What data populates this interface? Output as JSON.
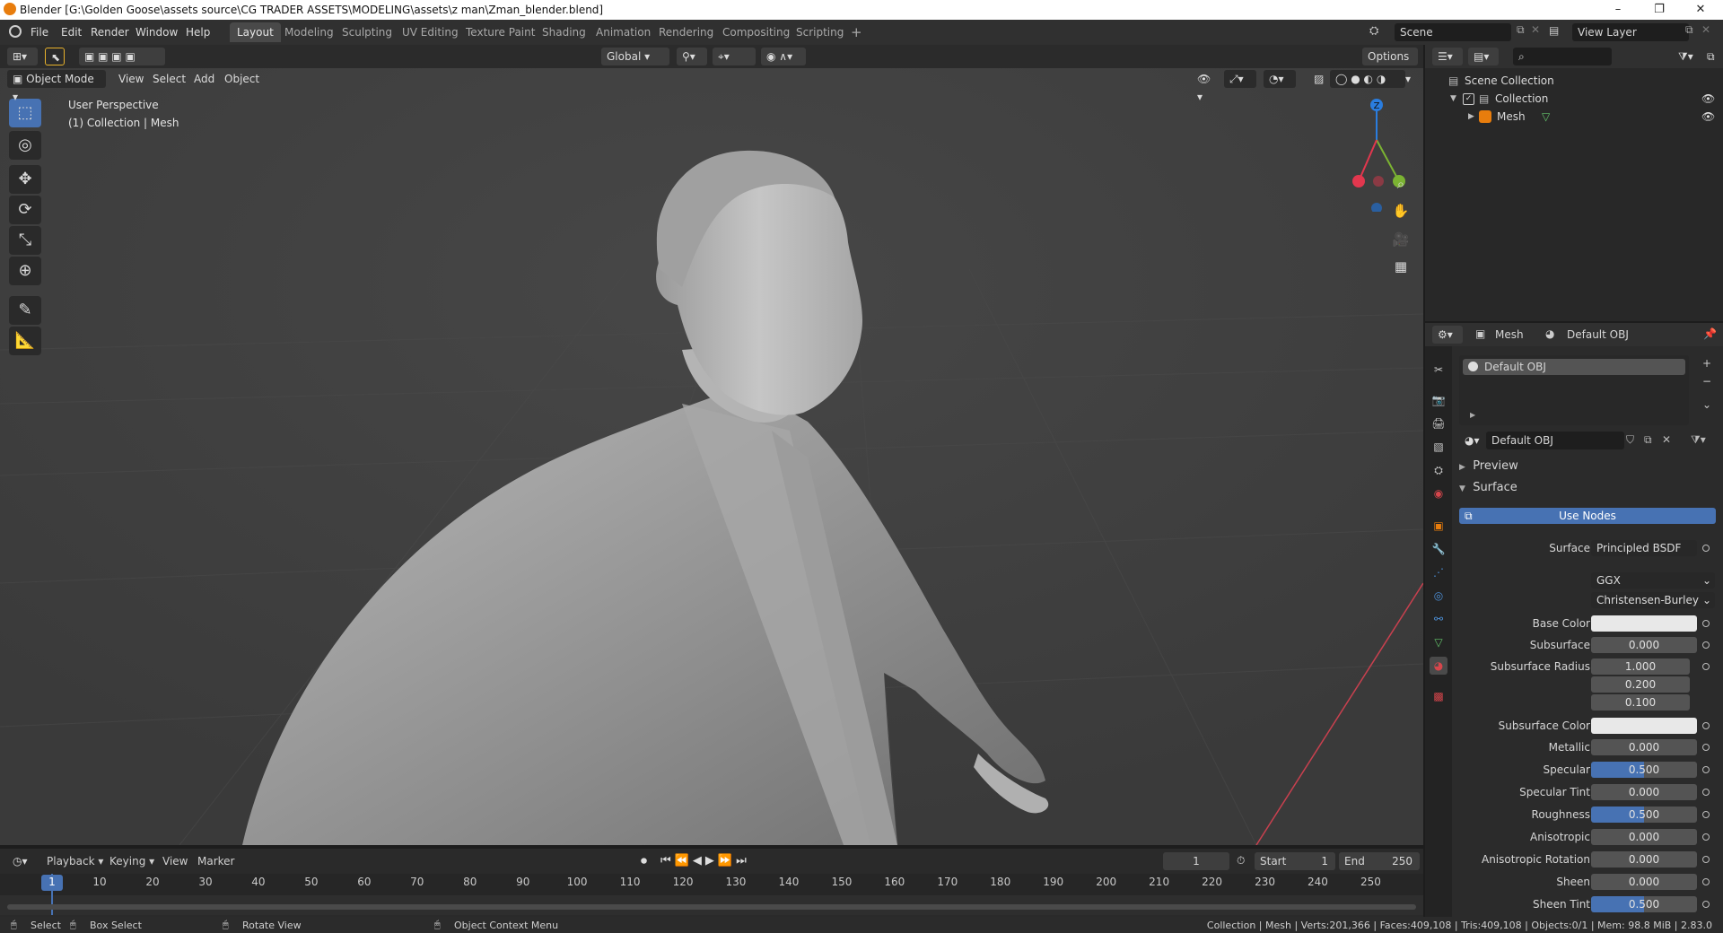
{
  "window": {
    "title": "Blender [G:\\Golden Goose\\assets source\\CG TRADER ASSETS\\MODELING\\assets\\z man\\Zman_blender.blend]",
    "minimize": "–",
    "maximize": "❐",
    "close": "✕"
  },
  "menubar": {
    "menus": [
      "File",
      "Edit",
      "Render",
      "Window",
      "Help"
    ],
    "workspaces": [
      "Layout",
      "Modeling",
      "Sculpting",
      "UV Editing",
      "Texture Paint",
      "Shading",
      "Animation",
      "Rendering",
      "Compositing",
      "Scripting"
    ],
    "add_workspace": "+",
    "scene_name": "Scene",
    "view_layer_name": "View Layer"
  },
  "viewport": {
    "transform_orientation": "Global",
    "options_label": "Options",
    "mode": "Object Mode",
    "menus": [
      "View",
      "Select",
      "Add",
      "Object"
    ],
    "overlay_text_line1": "User Perspective",
    "overlay_text_line2": "(1) Collection | Mesh",
    "gizmo_z": "Z"
  },
  "timeline": {
    "menus": [
      "Playback",
      "Keying",
      "View",
      "Marker"
    ],
    "current_frame": "1",
    "start_label": "Start",
    "start_value": "1",
    "end_label": "End",
    "end_value": "250",
    "ticks": [
      "1",
      "10",
      "20",
      "30",
      "40",
      "50",
      "60",
      "70",
      "80",
      "90",
      "100",
      "110",
      "120",
      "130",
      "140",
      "150",
      "160",
      "170",
      "180",
      "190",
      "200",
      "210",
      "220",
      "230",
      "240",
      "250"
    ]
  },
  "statusbar": {
    "select": "Select",
    "box_select": "Box Select",
    "rotate_view": "Rotate View",
    "context_menu": "Object Context Menu",
    "stats": "Collection | Mesh | Verts:201,366 | Faces:409,108 | Tris:409,108 | Objects:0/1 | Mem: 98.8 MiB | 2.83.0"
  },
  "outliner": {
    "scene_collection": "Scene Collection",
    "collection": "Collection",
    "mesh": "Mesh"
  },
  "properties": {
    "header_object": "Mesh",
    "header_material": "Default OBJ",
    "slot_name": "Default OBJ",
    "material_name": "Default OBJ",
    "preview_label": "Preview",
    "surface_panel": "Surface",
    "use_nodes": "Use Nodes",
    "surface_label": "Surface",
    "surface_shader": "Principled BSDF",
    "distribution": "GGX",
    "subsurface_method": "Christensen-Burley",
    "rows": [
      {
        "label": "Base Color",
        "value": "",
        "type": "color"
      },
      {
        "label": "Subsurface",
        "value": "0.000",
        "type": "number"
      },
      {
        "label": "Subsurface Radius",
        "value": "1.000",
        "type": "number"
      },
      {
        "label": "",
        "value": "0.200",
        "type": "number"
      },
      {
        "label": "",
        "value": "0.100",
        "type": "number"
      },
      {
        "label": "Subsurface Color",
        "value": "",
        "type": "color"
      },
      {
        "label": "Metallic",
        "value": "0.000",
        "type": "number"
      },
      {
        "label": "Specular",
        "value": "0.500",
        "type": "slider",
        "fill": 0.5
      },
      {
        "label": "Specular Tint",
        "value": "0.000",
        "type": "number"
      },
      {
        "label": "Roughness",
        "value": "0.500",
        "type": "slider",
        "fill": 0.5
      },
      {
        "label": "Anisotropic",
        "value": "0.000",
        "type": "number"
      },
      {
        "label": "Anisotropic Rotation",
        "value": "0.000",
        "type": "number"
      },
      {
        "label": "Sheen",
        "value": "0.000",
        "type": "number"
      },
      {
        "label": "Sheen Tint",
        "value": "0.500",
        "type": "slider",
        "fill": 0.5
      }
    ]
  },
  "colors": {
    "accent": "#4772b3",
    "viewport_bg": "#3d3d3d",
    "panel_bg": "#2b2b2b",
    "axis_x": "#e2374e",
    "axis_y": "#7bb332",
    "axis_z": "#2a7ddf"
  }
}
